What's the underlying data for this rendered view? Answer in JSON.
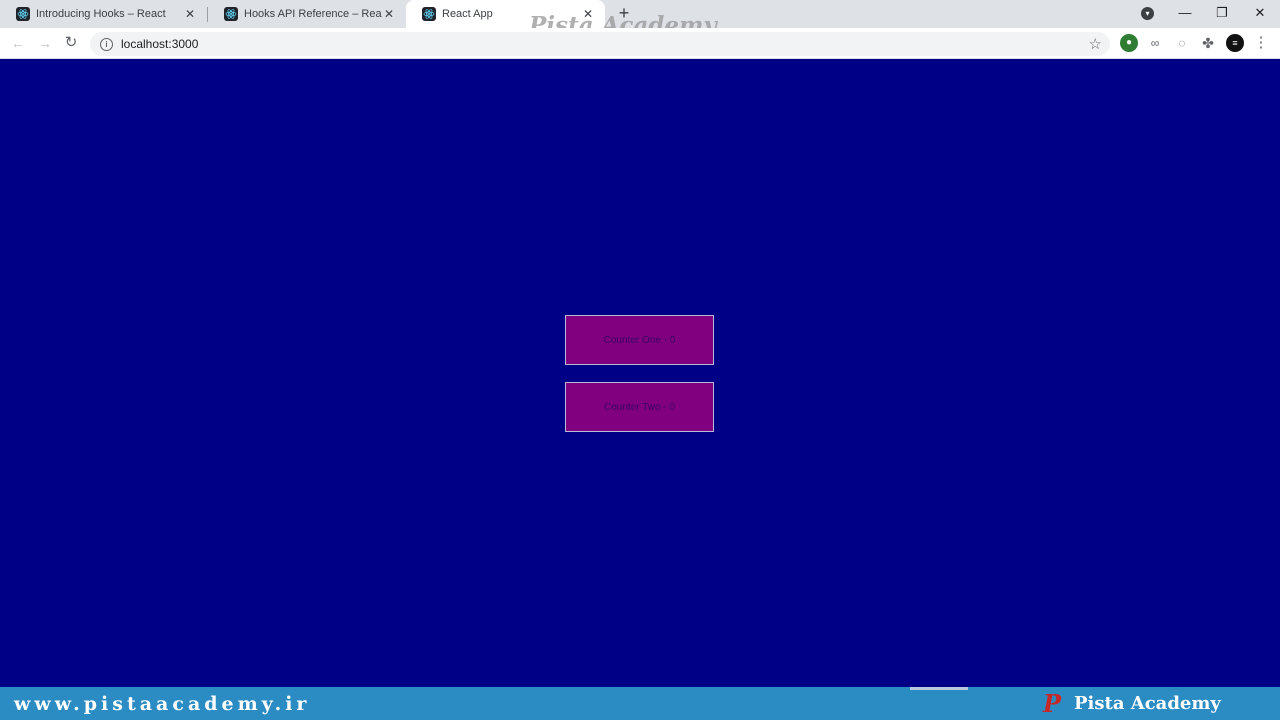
{
  "browser": {
    "tabs": [
      {
        "title": "Introducing Hooks – React",
        "active": false
      },
      {
        "title": "Hooks API Reference – React",
        "active": false
      },
      {
        "title": "React App",
        "active": true
      }
    ],
    "url": "localhost:3000",
    "icons": {
      "new_tab": "plus-icon",
      "back": "arrow-left-icon",
      "forward": "arrow-right-icon",
      "reload": "reload-icon",
      "site_info": "info-icon",
      "bookmark": "star-icon",
      "extensions": "puzzle-icon"
    },
    "glyphs": {
      "close": "✕",
      "plus": "+",
      "back": "←",
      "forward": "→",
      "reload": "↻",
      "info": "i",
      "star": "☆",
      "puzzle": "✤",
      "menu": "⋮",
      "minimize": "—",
      "maximize": "❐",
      "window_close": "✕",
      "dropdown": "▾"
    }
  },
  "watermark": {
    "top": "Pista Academy"
  },
  "page": {
    "background": "#000086",
    "counter_one_label": "Counter One - 0",
    "counter_two_label": "Counter Two - 0",
    "button_color": "#800080"
  },
  "banner": {
    "website": "www.pistaacademy.ir",
    "logo_letter": "P",
    "brand": "Pista Academy",
    "background": "#2b8cc4"
  }
}
